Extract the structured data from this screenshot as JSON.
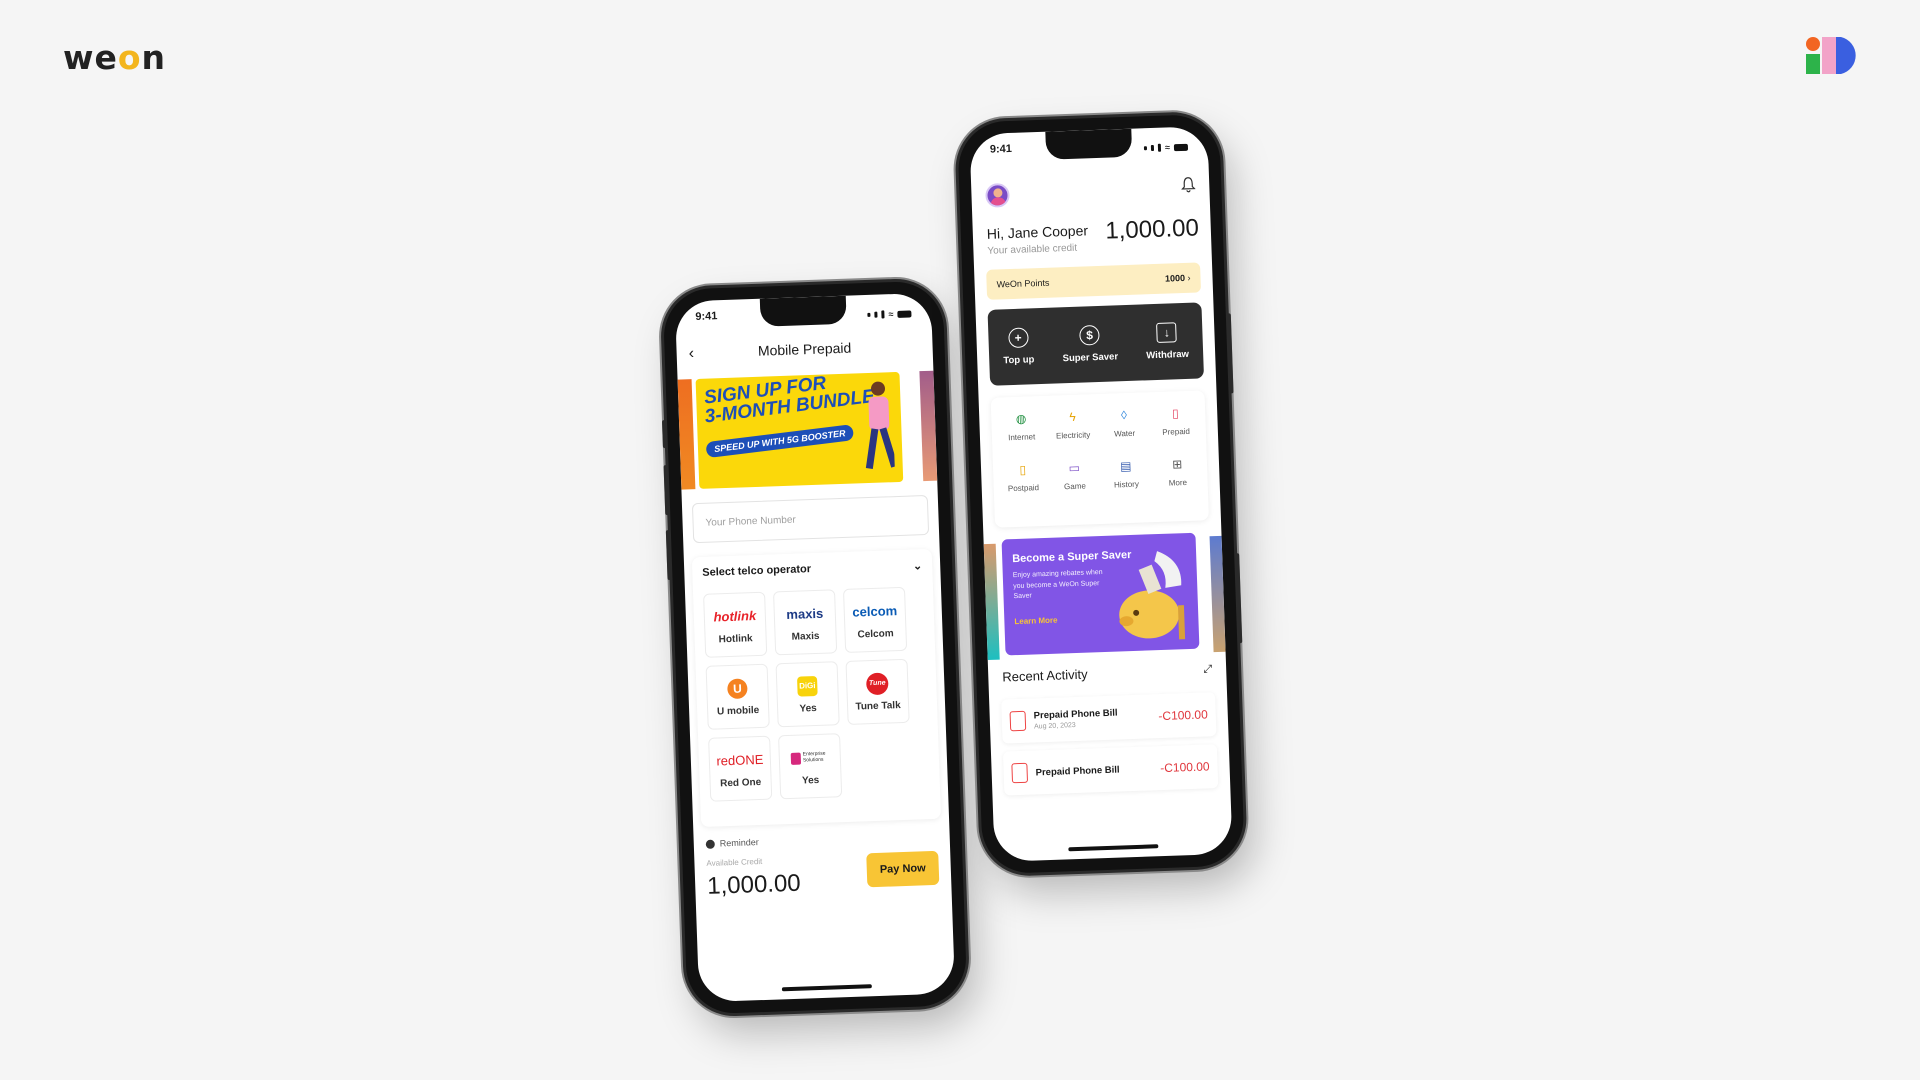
{
  "brand": {
    "logo_pre": "we",
    "logo_o": "o",
    "logo_post": "n"
  },
  "left_phone": {
    "time": "9:41",
    "title": "Mobile Prepaid",
    "banner": {
      "line1": "SIGN UP FOR",
      "line2": "3-MONTH BUNDLE",
      "line3": "SPEED UP WITH 5G BOOSTER"
    },
    "phone_input_placeholder": "Your Phone Number",
    "operator_heading": "Select telco operator",
    "operators": [
      {
        "logo": "hotlink",
        "name": "Hotlink",
        "color": "#e8232a"
      },
      {
        "logo": "maxis",
        "name": "Maxis",
        "color": "#1aa43a"
      },
      {
        "logo": "celcom",
        "name": "Celcom",
        "color": "#0a5bb5"
      },
      {
        "logo": "U",
        "name": "U mobile",
        "color": "#f58220"
      },
      {
        "logo": "DiGi",
        "name": "Yes",
        "color": "#f8d30b"
      },
      {
        "logo": "Tune",
        "name": "Tune Talk",
        "color": "#e01f26"
      },
      {
        "logo": "redONE",
        "name": "Red One",
        "color": "#e01f26"
      },
      {
        "logo": "Enterprise Solutions",
        "name": "Yes",
        "color": "#d6287d"
      }
    ],
    "reminder": "Reminder",
    "available_credit_label": "Available Credit",
    "amount": "1,000.00",
    "pay_button": "Pay Now"
  },
  "right_phone": {
    "time": "9:41",
    "greeting": "Hi, Jane Cooper",
    "sub": "Your available credit",
    "balance": "1,000.00",
    "points_label": "WeOn Points",
    "points_value": "1000",
    "actions": [
      {
        "icon": "plus-circle-icon",
        "label": "Top up"
      },
      {
        "icon": "dollar-circle-icon",
        "label": "Super Saver"
      },
      {
        "icon": "withdraw-icon",
        "label": "Withdraw"
      }
    ],
    "services": [
      {
        "icon": "globe-icon",
        "label": "Internet",
        "color": "#1e8e3e"
      },
      {
        "icon": "bolt-icon",
        "label": "Electricity",
        "color": "#e6a200"
      },
      {
        "icon": "drop-icon",
        "label": "Water",
        "color": "#3a8dde"
      },
      {
        "icon": "phone-icon",
        "label": "Prepaid",
        "color": "#e4405f"
      },
      {
        "icon": "phone-icon",
        "label": "Postpaid",
        "color": "#e6a200"
      },
      {
        "icon": "game-icon",
        "label": "Game",
        "color": "#7a4cc6"
      },
      {
        "icon": "history-icon",
        "label": "History",
        "color": "#3a5fb0"
      },
      {
        "icon": "grid-icon",
        "label": "More",
        "color": "#555555"
      }
    ],
    "promo": {
      "title": "Become a Super Saver",
      "desc": "Enjoy amazing rebates when you become a WeOn Super Saver",
      "cta": "Learn More"
    },
    "recent_title": "Recent Activity",
    "activities": [
      {
        "name": "Prepaid Phone Bill",
        "date": "Aug 20, 2023",
        "amount": "-C100.00"
      },
      {
        "name": "Prepaid Phone Bill",
        "date": "",
        "amount": "-C100.00"
      }
    ]
  }
}
